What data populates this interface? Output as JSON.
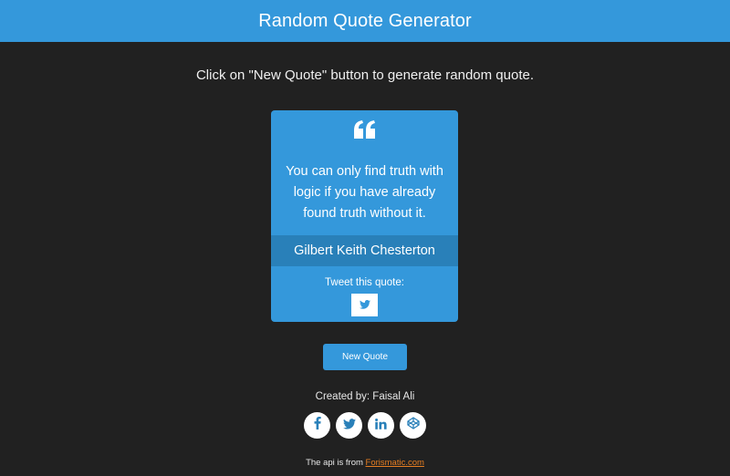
{
  "header": {
    "title": "Random Quote Generator"
  },
  "intro": {
    "text": "Click on \"New Quote\" button to generate random quote."
  },
  "quote": {
    "icon": "quote-left-icon",
    "text": "You can only find truth with logic if you have already found truth without it.",
    "author": "Gilbert Keith Chesterton",
    "tweet_label": "Tweet this quote:"
  },
  "actions": {
    "new_quote_label": "New Quote"
  },
  "credit": {
    "text": "Created by: Faisal Ali"
  },
  "social": [
    {
      "name": "facebook-icon"
    },
    {
      "name": "twitter-icon"
    },
    {
      "name": "linkedin-icon"
    },
    {
      "name": "codepen-icon"
    }
  ],
  "footer": {
    "prefix": "The api is from ",
    "link_text": "Forismatic.com"
  },
  "colors": {
    "accent": "#3498db",
    "author_bar": "#2980b9",
    "background": "#212121",
    "link": "#e67e22"
  }
}
